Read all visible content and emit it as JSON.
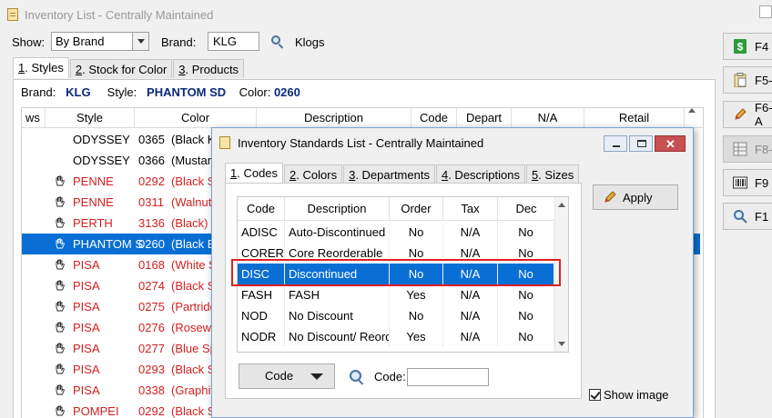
{
  "main_window": {
    "title": "Inventory List - Centrally Maintained"
  },
  "toolbar": {
    "show_label": "Show:",
    "show_value": "By Brand",
    "brand_label": "Brand:",
    "brand_value": "KLG",
    "brand_name": "Klogs"
  },
  "main_tabs": [
    {
      "num": "1",
      "label": ". Styles"
    },
    {
      "num": "2",
      "label": ". Stock for Color"
    },
    {
      "num": "3",
      "label": ". Products"
    }
  ],
  "info": {
    "brand_label": "Brand:",
    "brand_value": "KLG",
    "style_label": "Style:",
    "style_value": "PHANTOM SD",
    "color_label": "Color:",
    "color_value": "0260"
  },
  "main_grid": {
    "headers": [
      "ws",
      "Style",
      "Color",
      "Description",
      "Code",
      "Depart",
      "N/A",
      "Retail"
    ],
    "rows": [
      {
        "style": "ODYSSEY",
        "code": "0365",
        "color": "(Black K",
        "red": false,
        "hand": false
      },
      {
        "style": "ODYSSEY",
        "code": "0366",
        "color": "(Mustar",
        "red": false,
        "hand": false
      },
      {
        "style": "PENNE",
        "code": "0292",
        "color": "(Black S",
        "red": true,
        "hand": true
      },
      {
        "style": "PENNE",
        "code": "0311",
        "color": "(Walnut",
        "red": true,
        "hand": true
      },
      {
        "style": "PERTH",
        "code": "3136",
        "color": "(Black)",
        "red": true,
        "hand": true
      },
      {
        "style": "PHANTOM S",
        "code": "0260",
        "color": "(Black E",
        "red": false,
        "hand": true,
        "selected": true
      },
      {
        "style": "PISA",
        "code": "0168",
        "color": "(White S",
        "red": true,
        "hand": true
      },
      {
        "style": "PISA",
        "code": "0274",
        "color": "(Black S",
        "red": true,
        "hand": true
      },
      {
        "style": "PISA",
        "code": "0275",
        "color": "(Partridg",
        "red": true,
        "hand": true
      },
      {
        "style": "PISA",
        "code": "0276",
        "color": "(Rosew",
        "red": true,
        "hand": true
      },
      {
        "style": "PISA",
        "code": "0277",
        "color": "(Blue Sp",
        "red": true,
        "hand": true
      },
      {
        "style": "PISA",
        "code": "0293",
        "color": "(Black S",
        "red": true,
        "hand": true
      },
      {
        "style": "PISA",
        "code": "0338",
        "color": "(Graphit",
        "red": true,
        "hand": true
      },
      {
        "style": "POMPEI",
        "code": "0292",
        "color": "(Black S",
        "red": true,
        "hand": true
      }
    ]
  },
  "right_buttons": [
    {
      "label": "F4",
      "icon": "dollar-icon",
      "disabled": false
    },
    {
      "label": "F5-",
      "icon": "clipboard-icon",
      "disabled": false
    },
    {
      "label": "F6-A",
      "icon": "pencil-icon",
      "disabled": false
    },
    {
      "label": "F8-",
      "icon": "grid-icon",
      "disabled": true
    },
    {
      "label": "F9",
      "icon": "barcode-icon",
      "disabled": false
    },
    {
      "label": "F1",
      "icon": "search-icon",
      "disabled": false
    }
  ],
  "dialog": {
    "title": "Inventory Standards List - Centrally Maintained",
    "tabs": [
      {
        "num": "1",
        "label": ". Codes"
      },
      {
        "num": "2",
        "label": ". Colors"
      },
      {
        "num": "3",
        "label": ". Departments"
      },
      {
        "num": "4",
        "label": ". Descriptions"
      },
      {
        "num": "5",
        "label": ". Sizes"
      }
    ],
    "headers": [
      "Code",
      "Description",
      "Order",
      "Tax",
      "Dec"
    ],
    "rows": [
      {
        "code": "ADISC",
        "description": "Auto-Discontinued",
        "order": "No",
        "tax": "N/A",
        "dec": "No"
      },
      {
        "code": "CORER",
        "description": "Core Reorderable",
        "order": "No",
        "tax": "N/A",
        "dec": "No"
      },
      {
        "code": "DISC",
        "description": "Discontinued",
        "order": "No",
        "tax": "N/A",
        "dec": "No",
        "selected": true
      },
      {
        "code": "FASH",
        "description": "FASH",
        "order": "Yes",
        "tax": "N/A",
        "dec": "No"
      },
      {
        "code": "NOD",
        "description": "No Discount",
        "order": "No",
        "tax": "N/A",
        "dec": "No"
      },
      {
        "code": "NODR",
        "description": "No Discount/ Reorde",
        "order": "Yes",
        "tax": "N/A",
        "dec": "No"
      }
    ],
    "sort_button": "Code",
    "code_label": "Code:",
    "code_value": "",
    "apply_label": "Apply",
    "show_image_label": "Show image",
    "show_image_checked": true
  }
}
